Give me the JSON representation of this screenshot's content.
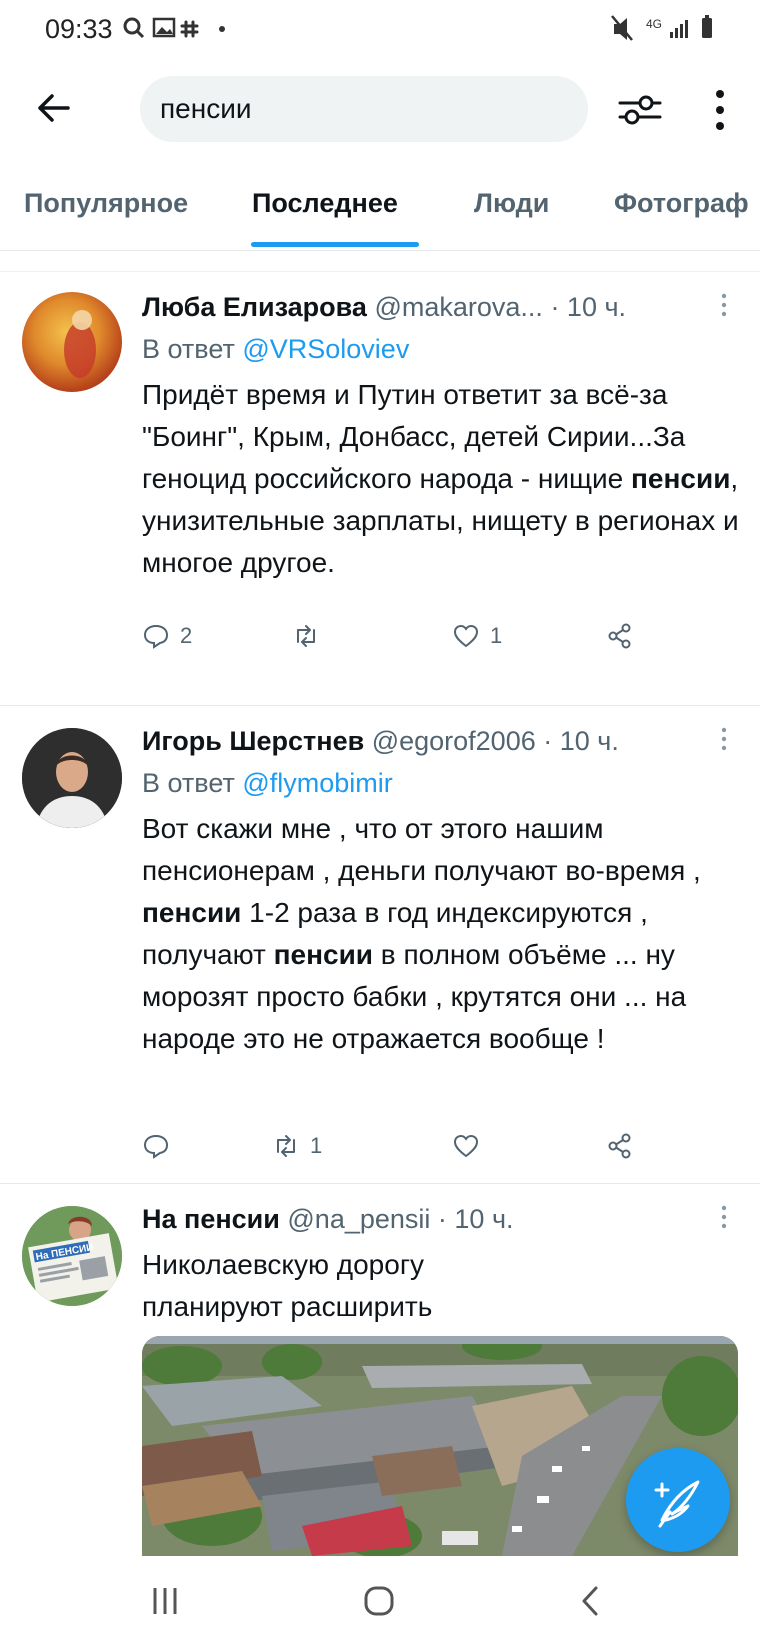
{
  "status_bar": {
    "time": "09:33",
    "left_icons": [
      "search-icon",
      "gallery-icon",
      "slack-icon",
      "dot-icon"
    ],
    "right_icons": [
      "mute-icon",
      "4g-icon",
      "signal-icon",
      "battery-icon"
    ],
    "network_label": "4G"
  },
  "header": {
    "search_value": "пенсии",
    "back_icon": "arrow-left-icon",
    "filter_icon": "sliders-icon",
    "more_icon": "more-vertical-icon"
  },
  "tabs": [
    {
      "label": "Популярное",
      "active": false
    },
    {
      "label": "Последнее",
      "active": true
    },
    {
      "label": "Люди",
      "active": false
    },
    {
      "label": "Фотограф",
      "active": false
    }
  ],
  "tweets": [
    {
      "name": "Люба Елизарова",
      "handle": "@makarova...",
      "time": "· 10 ч.",
      "reply_prefix": "В ответ",
      "reply_to": "@VRSoloviev",
      "text_parts": [
        "Придёт время и Путин ответит за всё-за \"Боинг\", Крым, Донбасс, детей Сирии...За геноцид российского народа - нищие ",
        "пенсии",
        ", унизительные зарплаты, нищету в регионах и многое другое."
      ],
      "replies": "2",
      "retweets": "",
      "likes": "1"
    },
    {
      "name": "Игорь Шерстнев",
      "handle": "@egorof2006",
      "time": "· 10 ч.",
      "reply_prefix": "В ответ",
      "reply_to": "@flymobimir",
      "text_parts": [
        "Вот скажи мне , что от этого нашим пенсионерам , деньги получают во-время , ",
        "пенсии",
        " 1-2 раза в год индексируются , получают ",
        "пенсии",
        " в полном объёме ... ну морозят просто бабки , крутятся они ... на народе это не отражается вообще !"
      ],
      "replies": "",
      "retweets": "1",
      "likes": ""
    },
    {
      "name": "На пенсии",
      "handle": "@na_pensii",
      "time": "· 10 ч.",
      "text": "Николаевскую дорогу планируют расширить",
      "avatar_text": "На ПЕНСИИ"
    }
  ],
  "colors": {
    "accent": "#1d9bf0",
    "text": "#0f1419",
    "secondary": "#536471"
  },
  "fab_icon": "compose-feather-icon",
  "nav_bar_icons": [
    "recent-apps-icon",
    "home-icon",
    "back-icon"
  ]
}
